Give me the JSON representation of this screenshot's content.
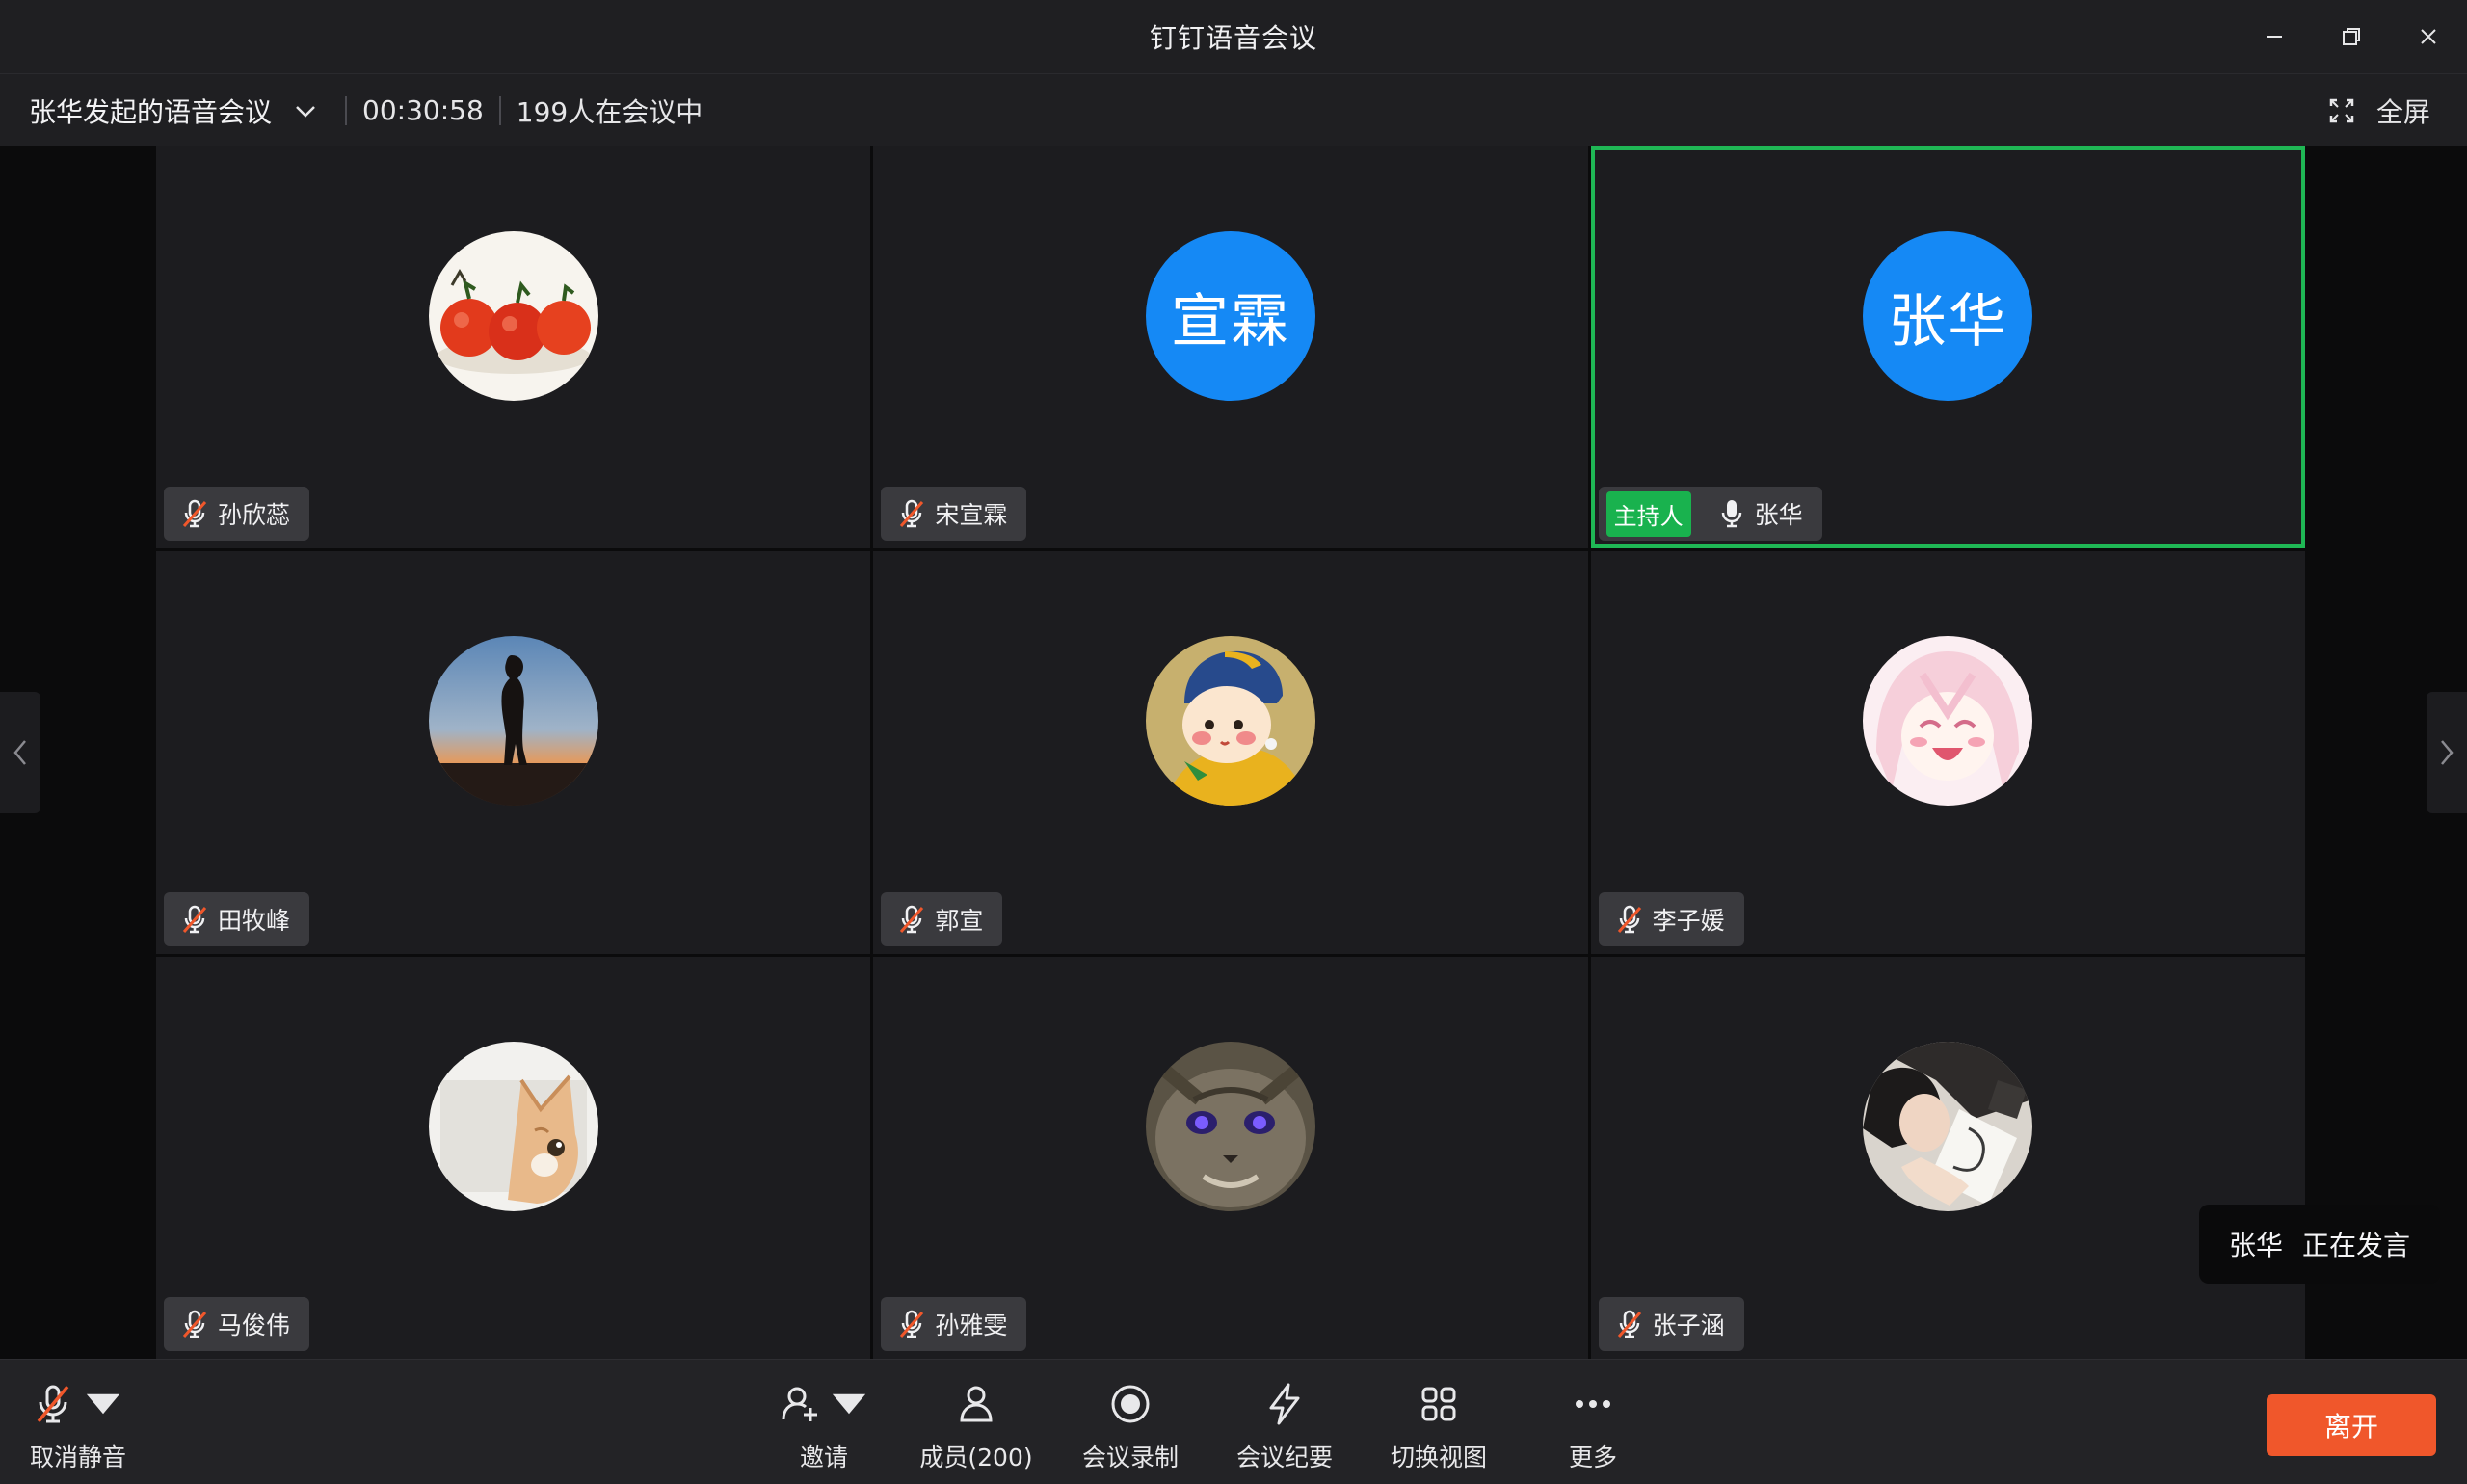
{
  "window": {
    "title": "钉钉语音会议"
  },
  "infobar": {
    "meeting_name": "张华发起的语音会议",
    "duration": "00:30:58",
    "participants_text": "199人在会议中",
    "fullscreen_label": "全屏"
  },
  "tiles": [
    {
      "name": "孙欣蕊",
      "avatar_type": "image",
      "avatar_desc": "tomatoes-photo",
      "muted": true
    },
    {
      "name": "宋宣霖",
      "avatar_type": "text",
      "avatar_text": "宣霖",
      "muted": true
    },
    {
      "name": "张华",
      "avatar_type": "text",
      "avatar_text": "张华",
      "muted": false,
      "host": true,
      "host_label": "主持人",
      "speaking": true
    },
    {
      "name": "田牧峰",
      "avatar_type": "image",
      "avatar_desc": "silhouette-sunset-photo",
      "muted": true
    },
    {
      "name": "郭宣",
      "avatar_type": "image",
      "avatar_desc": "cartoon-girl-pearl-earring",
      "muted": true
    },
    {
      "name": "李子媛",
      "avatar_type": "image",
      "avatar_desc": "anime-girl-laughing",
      "muted": true
    },
    {
      "name": "马俊伟",
      "avatar_type": "image",
      "avatar_desc": "cat-peeking-photo",
      "muted": true
    },
    {
      "name": "孙雅雯",
      "avatar_type": "image",
      "avatar_desc": "cat-glowing-eyes-photo",
      "muted": true
    },
    {
      "name": "张子涵",
      "avatar_type": "image",
      "avatar_desc": "person-drawing-photo",
      "muted": true
    }
  ],
  "speaking_toast": {
    "name": "张华",
    "status": "正在发言"
  },
  "toolbar": {
    "unmute_label": "取消静音",
    "invite_label": "邀请",
    "members_label": "成员(200)",
    "record_label": "会议录制",
    "minutes_label": "会议纪要",
    "switch_view_label": "切换视图",
    "more_label": "更多",
    "leave_label": "离开"
  },
  "colors": {
    "accent_blue": "#1589f5",
    "host_green": "#19b24e",
    "leave_orange": "#f0572b"
  }
}
